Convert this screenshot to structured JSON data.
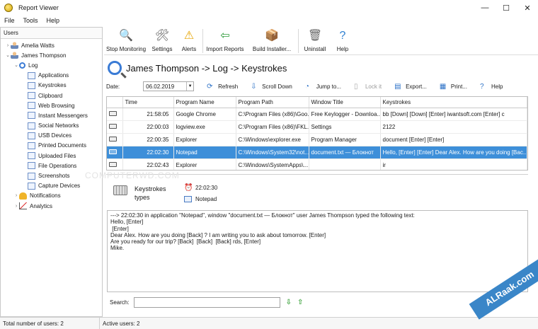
{
  "window": {
    "title": "Report Viewer",
    "controls": [
      "—",
      "☐",
      "✕"
    ]
  },
  "menu": [
    "File",
    "Tools",
    "Help"
  ],
  "sidebar": {
    "header": "Users",
    "tree": [
      {
        "label": "Amelia Watts",
        "icon": "user-icon",
        "level": 0,
        "arrow": "›"
      },
      {
        "label": "James Thompson",
        "icon": "user-icon",
        "level": 0,
        "arrow": "⌄"
      },
      {
        "label": "Log",
        "icon": "search-icon",
        "level": 1,
        "arrow": "⌄"
      },
      {
        "label": "Applications",
        "icon": "page-icon",
        "level": 2,
        "arrow": ""
      },
      {
        "label": "Keystrokes",
        "icon": "keyboard-icon",
        "level": 2,
        "arrow": ""
      },
      {
        "label": "Clipboard",
        "icon": "clipboard-icon",
        "level": 2,
        "arrow": ""
      },
      {
        "label": "Web Browsing",
        "icon": "globe-icon",
        "level": 2,
        "arrow": ""
      },
      {
        "label": "Instant Messengers",
        "icon": "chat-icon",
        "level": 2,
        "arrow": ""
      },
      {
        "label": "Social Networks",
        "icon": "people-icon",
        "level": 2,
        "arrow": ""
      },
      {
        "label": "USB Devices",
        "icon": "usb-icon",
        "level": 2,
        "arrow": ""
      },
      {
        "label": "Printed Documents",
        "icon": "printer-icon",
        "level": 2,
        "arrow": ""
      },
      {
        "label": "Uploaded Files",
        "icon": "upload-icon",
        "level": 2,
        "arrow": ""
      },
      {
        "label": "File Operations",
        "icon": "folder-icon",
        "level": 2,
        "arrow": ""
      },
      {
        "label": "Screenshots",
        "icon": "screenshot-icon",
        "level": 2,
        "arrow": ""
      },
      {
        "label": "Capture Devices",
        "icon": "webcam-icon",
        "level": 2,
        "arrow": ""
      },
      {
        "label": "Notifications",
        "icon": "bell-icon",
        "level": 1,
        "arrow": "›"
      },
      {
        "label": "Analytics",
        "icon": "chart-icon",
        "level": 1,
        "arrow": "›"
      }
    ]
  },
  "toolbar": [
    {
      "label": "Stop Monitoring",
      "icon": "stop-monitoring-icon",
      "glyph": "🔍",
      "color": "#c0392b"
    },
    {
      "label": "Settings",
      "icon": "settings-icon",
      "glyph": "🛠",
      "color": "#555555"
    },
    {
      "label": "Alerts",
      "icon": "alert-icon",
      "glyph": "⚠",
      "color": "#e6a400"
    },
    {
      "label": "Import Reports",
      "icon": "import-icon",
      "glyph": "⇦",
      "color": "#2e9b3a"
    },
    {
      "label": "Build Installer...",
      "icon": "build-installer-icon",
      "glyph": "📦",
      "color": "#a0702a"
    },
    {
      "label": "Uninstall",
      "icon": "uninstall-icon",
      "glyph": "🗑",
      "color": "#666666"
    },
    {
      "label": "Help",
      "icon": "help-icon",
      "glyph": "?",
      "color": "#2d7fd1"
    }
  ],
  "breadcrumb": "James Thompson -> Log -> Keystrokes",
  "filter": {
    "date_label": "Date:",
    "date_value": "06.02.2019",
    "buttons": [
      {
        "label": "Refresh",
        "icon": "refresh-icon",
        "glyph": "⟳",
        "disabled": false
      },
      {
        "label": "Scroll Down",
        "icon": "scroll-down-icon",
        "glyph": "⇩",
        "disabled": false
      },
      {
        "label": "Jump to...",
        "icon": "jump-to-icon",
        "glyph": "◔",
        "disabled": false
      },
      {
        "label": "Lock it",
        "icon": "lock-icon",
        "glyph": "▯",
        "disabled": true
      },
      {
        "label": "Export...",
        "icon": "export-icon",
        "glyph": "▤",
        "disabled": false
      },
      {
        "label": "Print...",
        "icon": "print-icon",
        "glyph": "▦",
        "disabled": false
      },
      {
        "label": "Help",
        "icon": "help-icon",
        "glyph": "?",
        "disabled": false
      }
    ]
  },
  "grid": {
    "columns": [
      "",
      "Time",
      "Program Name",
      "Program Path",
      "Window Title",
      "Keystrokes"
    ],
    "rows": [
      {
        "time": "21:58:05",
        "program": "Google Chrome",
        "path": "C:\\Program Files (x86)\\Goo...",
        "window": "Free Keylogger - Downloa...",
        "keys": "bb [Down]  [Down]  [Enter] iwantsoft.com [Enter] c",
        "selected": false
      },
      {
        "time": "22:00:03",
        "program": "logview.exe",
        "path": "C:\\Program Files (x86)\\FKL...",
        "window": "Settings",
        "keys": "2122",
        "selected": false
      },
      {
        "time": "22:00:35",
        "program": "Explorer",
        "path": "C:\\Windows\\explorer.exe",
        "window": "Program Manager",
        "keys": "document [Enter]  [Enter]",
        "selected": false
      },
      {
        "time": "22:02:30",
        "program": "Notepad",
        "path": "C:\\Windows\\System32\\not...",
        "window": "document.txt — Блокнот",
        "keys": "Hello, [Enter]  [Enter] Dear Alex. How are you doing [Bac...",
        "selected": true
      },
      {
        "time": "22:02:43",
        "program": "Explorer",
        "path": "C:\\Windows\\SystemApps\\...",
        "window": "",
        "keys": "ir",
        "selected": false
      }
    ]
  },
  "detail": {
    "label": "Keystrokes types",
    "time": "22:02:30",
    "app": "Notepad",
    "log": "---> 22:02:30 in application \"Notepad\", window \"document.txt — Блокнот\" user James Thompson typed the following text:\nHello, [Enter]\n [Enter]\nDear Alex. How are you doing [Back] ? I am writing you to ask about tomorrow. [Enter]\nAre you ready for our trip? [Back]  [Back]  [Back] rds, [Enter]\nMike."
  },
  "search": {
    "label": "Search:",
    "value": ""
  },
  "status": {
    "total": "Total number of users: 2",
    "active": "Active users: 2"
  },
  "watermarks": {
    "site": "ALRaak.com",
    "faint": "COMPUTERWD.COM"
  },
  "colors": {
    "selection": "#3d8fd9",
    "accent": "#2d7fd1"
  }
}
